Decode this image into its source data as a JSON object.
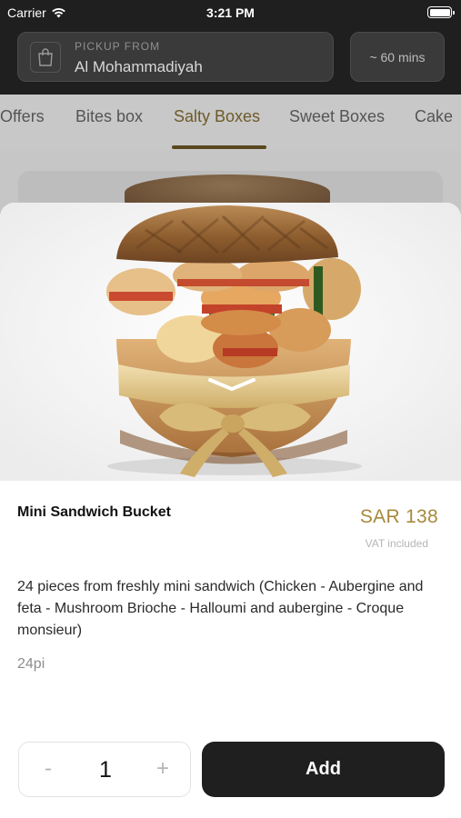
{
  "status_bar": {
    "carrier": "Carrier",
    "time": "3:21 PM"
  },
  "header": {
    "pickup_label": "PICKUP FROM",
    "pickup_location": "Al Mohammadiyah",
    "eta": "~ 60 mins"
  },
  "tabs": [
    {
      "label": "Offers",
      "active": false
    },
    {
      "label": "Bites box",
      "active": false
    },
    {
      "label": "Salty Boxes",
      "active": true
    },
    {
      "label": "Sweet Boxes",
      "active": false
    },
    {
      "label": "Cake",
      "active": false
    }
  ],
  "product": {
    "name": "Mini Sandwich Bucket",
    "price": "SAR 138",
    "vat_note": "VAT included",
    "description": "24 pieces from freshly mini sandwich (Chicken - Aubergine and feta - Mushroom Brioche - Halloumi and aubergine - Croque monsieur)",
    "quantity_note": "24pi"
  },
  "cart": {
    "minus_label": "-",
    "quantity": "1",
    "plus_label": "+",
    "add_label": "Add"
  },
  "colors": {
    "dark": "#1f1f1f",
    "accent_gold": "#a8893c",
    "background": "#ffffff"
  },
  "icons": [
    "wifi-icon",
    "battery-icon",
    "shopping-bag-icon",
    "chevron-down-icon"
  ]
}
